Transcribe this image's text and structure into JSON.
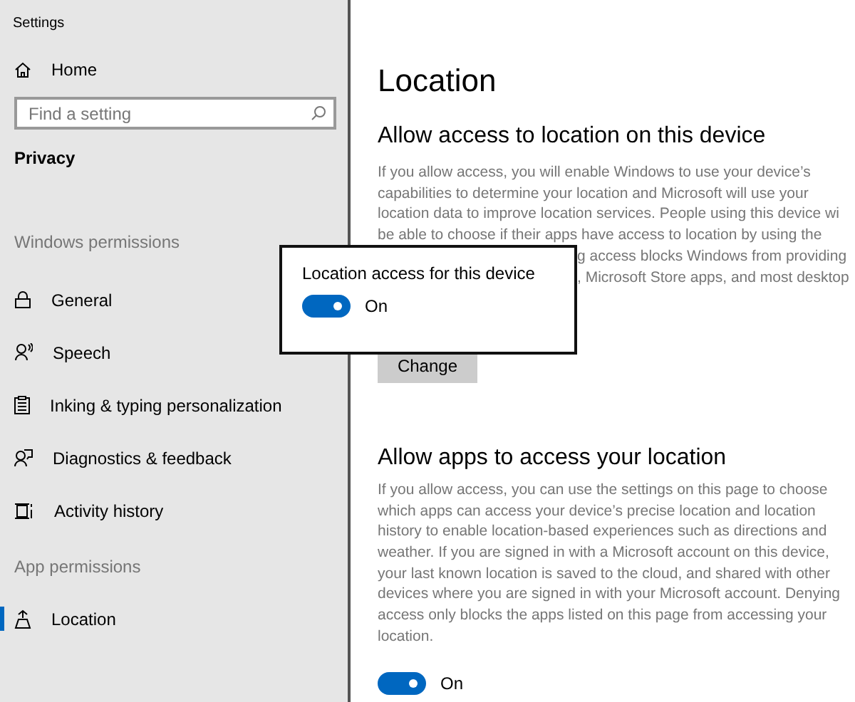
{
  "window": {
    "title": "Settings"
  },
  "sidebar": {
    "home": "Home",
    "search": {
      "placeholder": "Find a setting"
    },
    "section": "Privacy",
    "groups": [
      {
        "heading": "Windows permissions",
        "items": [
          {
            "label": "General",
            "selected": false
          },
          {
            "label": "Speech",
            "selected": false
          },
          {
            "label": "Inking & typing personalization",
            "selected": false
          },
          {
            "label": "Diagnostics & feedback",
            "selected": false
          },
          {
            "label": "Activity history",
            "selected": false
          }
        ]
      },
      {
        "heading": "App permissions",
        "items": [
          {
            "label": "Location",
            "selected": true
          }
        ]
      }
    ]
  },
  "main": {
    "title": "Location",
    "device_section": {
      "heading": "Allow access to location on this device",
      "lines": [
        "If you allow access, you will enable Windows to use your device’s",
        "capabilities to determine your location and Microsoft will use your",
        "location data to improve location services. People using this device wi",
        "be able to choose if their apps have access to location by using the"
      ],
      "partial_lines": [
        "g access blocks Windows from providing",
        ", Microsoft Store apps, and most desktop"
      ],
      "button": "Change"
    },
    "apps_section": {
      "heading": "Allow apps to access your location",
      "lines": [
        "If you allow access, you can use the settings on this page to choose",
        "which apps can access your device’s precise location and location",
        "history to enable location-based experiences such as directions and",
        "weather. If you are signed in with a Microsoft account on this device,",
        "your last known location is saved to the cloud, and shared with other",
        "devices where you are signed in with your Microsoft account. Denying",
        "access only blocks the apps listed on this page from accessing your",
        "location."
      ],
      "toggle": {
        "on": true,
        "label": "On"
      }
    }
  },
  "popup": {
    "label": "Location access for this device",
    "toggle": {
      "on": true,
      "label": "On"
    }
  }
}
